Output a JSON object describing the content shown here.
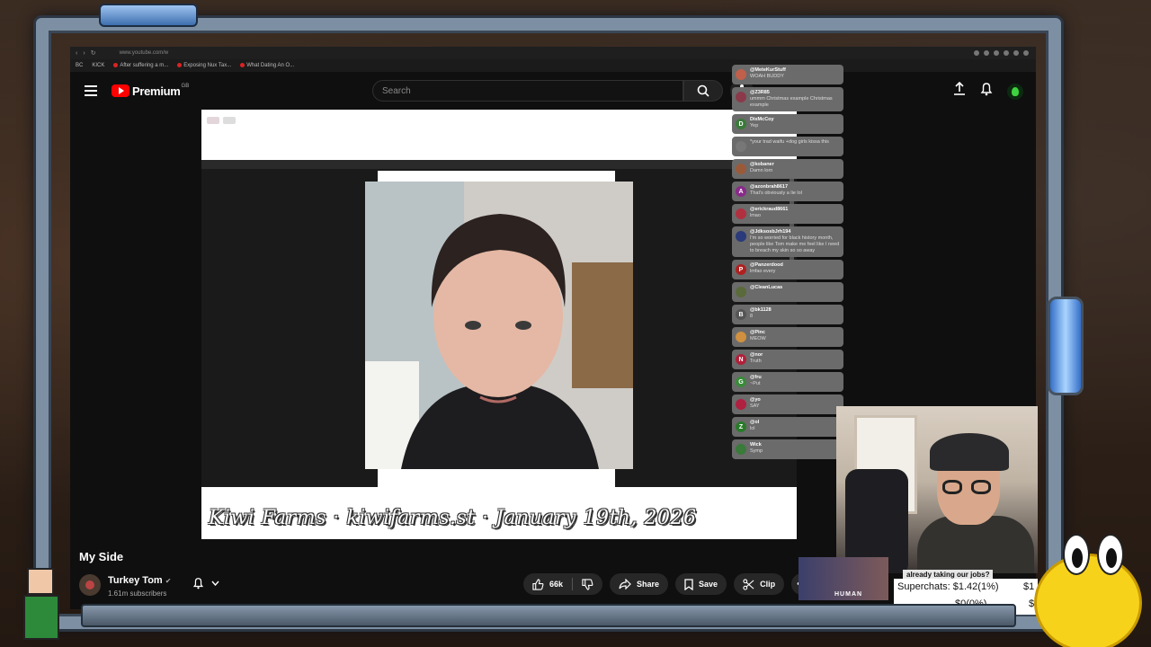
{
  "browser": {
    "url": "www.youtube.com/w",
    "bookmarks": [
      "BC",
      "KICK",
      "After suffering a m...",
      "Exposing Nux Tax...",
      "What Dating An O..."
    ]
  },
  "header": {
    "logo_text": "Premium",
    "region": "GB",
    "search_placeholder": "Search",
    "icons": [
      "menu-icon",
      "search-icon",
      "mic-icon",
      "upload-icon",
      "bell-icon",
      "avatar"
    ]
  },
  "player": {
    "caption": "Kiwi Farms · kiwifarms.st · January 19th, 2026"
  },
  "chat": {
    "messages": [
      {
        "user": "@MeteKurStuff",
        "text": "WOAH BUDDY",
        "color": "#c0604a",
        "initial": ""
      },
      {
        "user": "@Z3R85",
        "text": "ummm Christmas example Christmas example",
        "color": "#8a3a4a",
        "initial": ""
      },
      {
        "user": "DixMcCoy",
        "text": "Yep",
        "color": "#3a7a3a",
        "initial": "D"
      },
      {
        "user": "",
        "text": "*your trad waifu +dog girls kissa this",
        "color": "#777777",
        "initial": ""
      },
      {
        "user": "@kobaner",
        "text": "Damn lorn",
        "color": "#9a5a3a",
        "initial": ""
      },
      {
        "user": "@azonbrah8617",
        "text": "That's obviously a lie lol",
        "color": "#8a2a8a",
        "initial": "A"
      },
      {
        "user": "@erickraud8661",
        "text": "lmao",
        "color": "#b03040",
        "initial": ""
      },
      {
        "user": "@JdksosbJrh194",
        "text": "I'm so worried for black history month, people like Tom make me feel like I need to breach my skin so so away",
        "color": "#2a3a7a",
        "initial": ""
      },
      {
        "user": "@Panzerdood",
        "text": "lmfao every",
        "color": "#b02020",
        "initial": "P"
      },
      {
        "user": "@CleanLucas",
        "text": "",
        "color": "#5a6a3a",
        "initial": ""
      },
      {
        "user": "@bk1128",
        "text": "8",
        "color": "#555555",
        "initial": "B"
      },
      {
        "user": "@Pinc",
        "text": "MEOW",
        "color": "#d09040",
        "initial": ""
      },
      {
        "user": "@nor",
        "text": "Truth",
        "color": "#b0203a",
        "initial": "N"
      },
      {
        "user": "@fru",
        "text": "~Put",
        "color": "#3a8a3a",
        "initial": "G"
      },
      {
        "user": "@yo",
        "text": "SAY",
        "color": "#b02040",
        "initial": ""
      },
      {
        "user": "@ol",
        "text": "lol",
        "color": "#2a7a2a",
        "initial": "Z"
      },
      {
        "user": "Wick",
        "text": "Symp",
        "color": "#3a7a3a",
        "initial": ""
      }
    ]
  },
  "video": {
    "title": "My Side",
    "channel": "Turkey Tom",
    "subscribers": "1.61m subscribers"
  },
  "actions": {
    "likes": "66k",
    "share": "Share",
    "save": "Save",
    "clip": "Clip"
  },
  "overlay": {
    "superchat_headline": "already taking our jobs?",
    "superchat_thumb_label": "HUMAN",
    "superchats": "Superchats: $1.42(1%)",
    "superchats_right": "$1",
    "zero": "$0(0%)",
    "zero_right": "$"
  },
  "colors": {
    "youtube_red": "#ff0000",
    "page_bg": "#0f0f0f",
    "button_bg": "#272727"
  }
}
